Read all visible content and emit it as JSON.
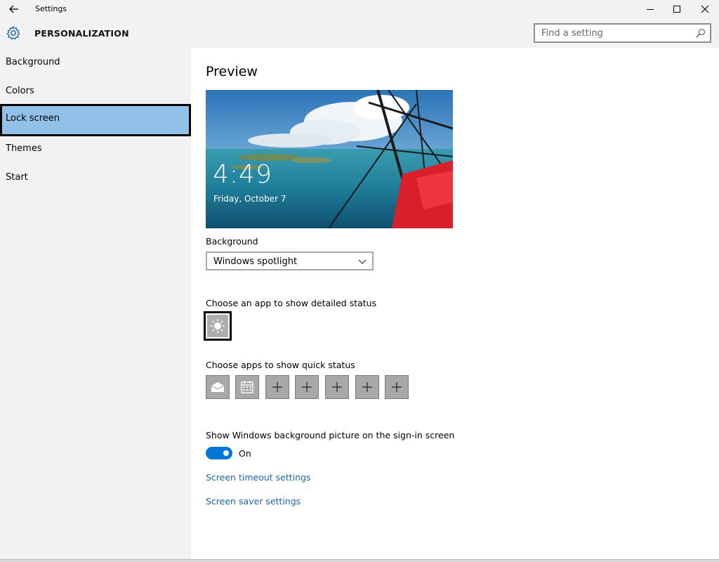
{
  "window": {
    "title": "Settings"
  },
  "header": {
    "section_title": "PERSONALIZATION",
    "search_placeholder": "Find a setting"
  },
  "sidebar": {
    "items": [
      {
        "label": "Background"
      },
      {
        "label": "Colors"
      },
      {
        "label": "Lock screen",
        "selected": true
      },
      {
        "label": "Themes"
      },
      {
        "label": "Start"
      }
    ]
  },
  "main": {
    "preview_title": "Preview",
    "preview_time": "4:49",
    "preview_date": "Friday, October 7",
    "background_label": "Background",
    "background_value": "Windows spotlight",
    "detailed_status_label": "Choose an app to show detailed status",
    "quick_status_label": "Choose apps to show quick status",
    "quick_status_tiles": [
      "mail-icon",
      "calendar-icon",
      "plus-icon",
      "plus-icon",
      "plus-icon",
      "plus-icon",
      "plus-icon"
    ],
    "signin_label": "Show Windows background picture on the sign-in screen",
    "toggle_state": "On",
    "link_timeout": "Screen timeout settings",
    "link_saver": "Screen saver settings"
  },
  "colors": {
    "accent": "#0078d7",
    "selected_nav": "#91c1e8",
    "link": "#1a64a8"
  }
}
